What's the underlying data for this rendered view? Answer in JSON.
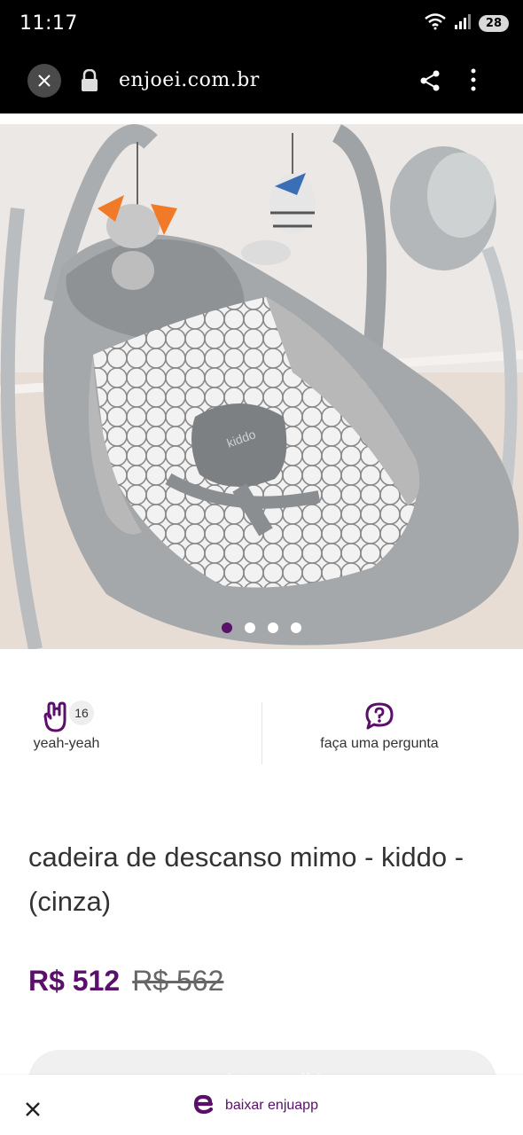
{
  "status_bar": {
    "time": "11:17",
    "battery": "28"
  },
  "browser": {
    "url": "enjoei.com.br"
  },
  "gallery": {
    "total": 4,
    "active_index": 0
  },
  "actions": {
    "like_count": "16",
    "like_label": "yeah-yeah",
    "ask_label": "faça uma pergunta"
  },
  "product": {
    "title": "cadeira de descanso mimo - kiddo - (cinza)",
    "price": "R$ 512",
    "old_price": "R$ 562",
    "sold_label": "produto vendido"
  },
  "bottom_bar": {
    "app_label": "baixar enjuapp"
  },
  "colors": {
    "brand": "#5a0f6a"
  }
}
